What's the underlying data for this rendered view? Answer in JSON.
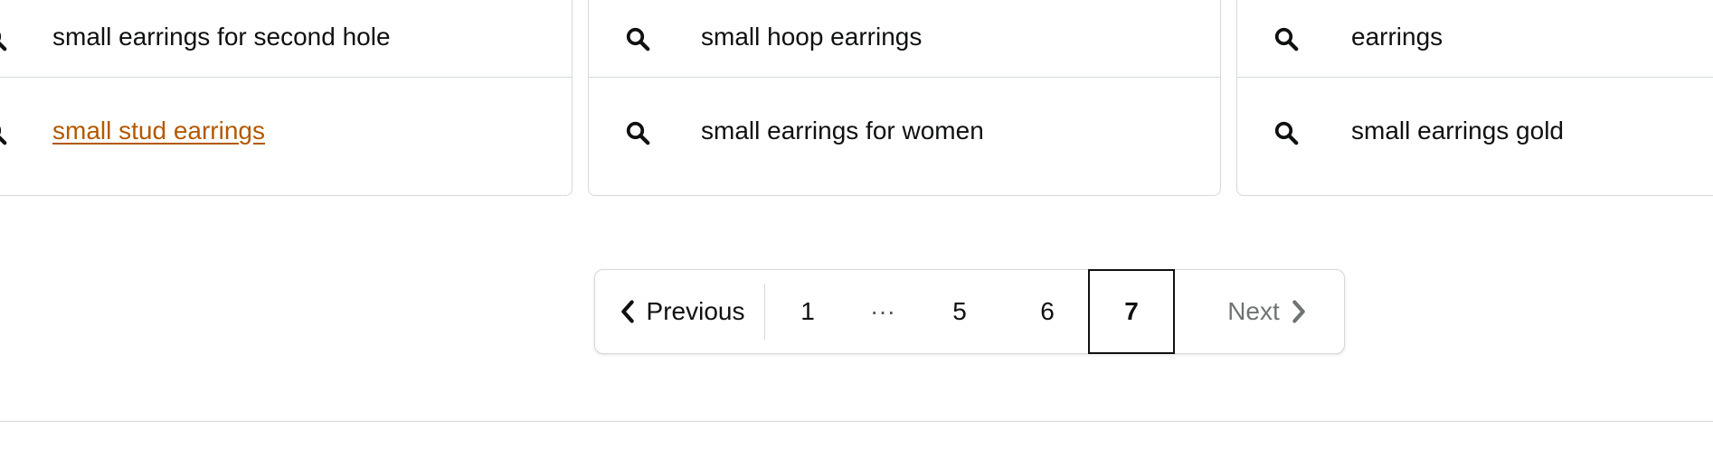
{
  "related_searches": {
    "columns": [
      {
        "items": [
          {
            "label": "small earrings for second hole",
            "visited": false
          },
          {
            "label": "small stud earrings",
            "visited": true
          }
        ]
      },
      {
        "items": [
          {
            "label": "small hoop earrings",
            "icon": "search-icon"
          },
          {
            "label": "small earrings for women",
            "icon": "search-icon"
          }
        ]
      },
      {
        "items": [
          {
            "label": "earrings",
            "icon": "search-icon"
          },
          {
            "label": "small earrings gold",
            "icon": "search-icon"
          }
        ]
      }
    ],
    "visited_color": "#b35900"
  },
  "pagination": {
    "previous_label": "Previous",
    "previous_icon": "chevron-left-icon",
    "pages": [
      "1",
      "5",
      "6",
      "7"
    ],
    "ellipsis": "···",
    "current_page": "7",
    "next_label": "Next",
    "next_icon": "chevron-right-icon",
    "next_disabled": true
  }
}
